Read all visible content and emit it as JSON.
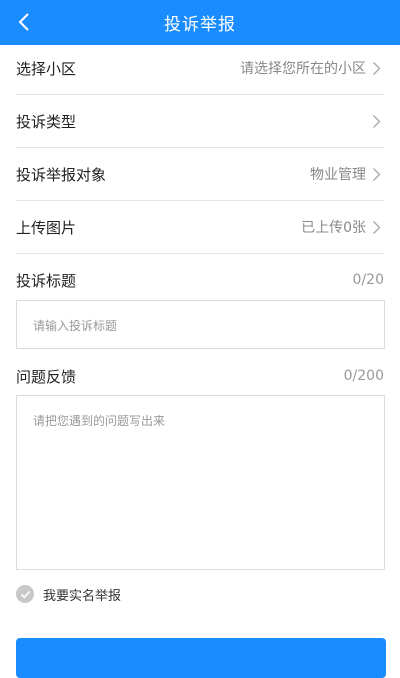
{
  "header": {
    "title": "投诉举报"
  },
  "rows": [
    {
      "label": "选择小区",
      "value": "请选择您所在的小区"
    },
    {
      "label": "投诉类型",
      "value": ""
    },
    {
      "label": "投诉举报对象",
      "value": "物业管理"
    },
    {
      "label": "上传图片",
      "value": "已上传0张"
    }
  ],
  "complaint_title": {
    "label": "投诉标题",
    "count": "0/20",
    "placeholder": "请输入投诉标题"
  },
  "feedback": {
    "label": "问题反馈",
    "count": "0/200",
    "placeholder": "请把您遇到的问题写出来"
  },
  "realname": {
    "label": "我要实名举报",
    "checked": false
  },
  "colors": {
    "primary": "#1a8cff",
    "divider": "#e4e4e4",
    "muted": "#888888"
  }
}
